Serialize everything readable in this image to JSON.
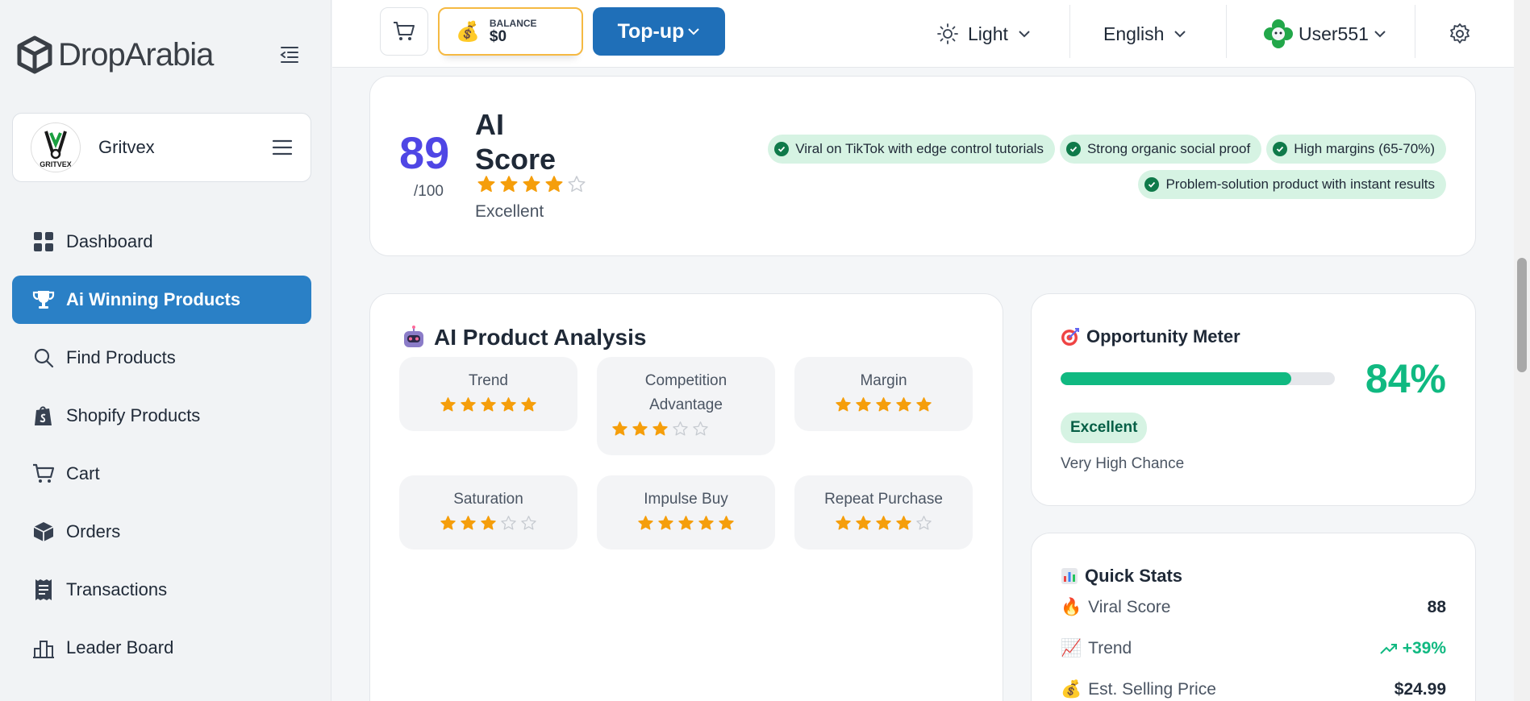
{
  "brand": {
    "name": "DropArabia"
  },
  "store": {
    "name": "Gritvex",
    "logo_text": "GRITVEX"
  },
  "sidebar": {
    "items": [
      {
        "label": "Dashboard",
        "icon": "grid-icon"
      },
      {
        "label": "Ai Winning Products",
        "icon": "trophy-icon",
        "active": true
      },
      {
        "label": "Find Products",
        "icon": "search-icon"
      },
      {
        "label": "Shopify Products",
        "icon": "shopify-bag-icon"
      },
      {
        "label": "Cart",
        "icon": "cart-icon"
      },
      {
        "label": "Orders",
        "icon": "box-icon"
      },
      {
        "label": "Transactions",
        "icon": "receipt-icon"
      },
      {
        "label": "Leader Board",
        "icon": "podium-icon"
      }
    ]
  },
  "topbar": {
    "balance_label": "BALANCE",
    "balance_value": "$0",
    "topup_label": "Top-up",
    "theme_label": "Light",
    "language_label": "English",
    "user_label": "User551"
  },
  "ai_score": {
    "value": "89",
    "out_of": "/100",
    "title": "AI Score",
    "rating": 4,
    "rating_label": "Excellent",
    "tags": [
      "Viral on TikTok with edge control tutorials",
      "Strong organic social proof",
      "High margins (65-70%)",
      "Problem-solution product with instant results"
    ]
  },
  "analysis": {
    "title": "AI Product Analysis",
    "metrics": [
      {
        "label": "Trend",
        "rating": 5
      },
      {
        "label": "Competition Advantage",
        "rating": 3
      },
      {
        "label": "Margin",
        "rating": 5
      },
      {
        "label": "Saturation",
        "rating": 3
      },
      {
        "label": "Impulse Buy",
        "rating": 5
      },
      {
        "label": "Repeat Purchase",
        "rating": 4
      }
    ]
  },
  "opportunity": {
    "title": "Opportunity Meter",
    "percent": 84,
    "percent_label": "84%",
    "badge": "Excellent",
    "subtitle": "Very High Chance"
  },
  "quick_stats": {
    "title": "Quick Stats",
    "rows": [
      {
        "label": "Viral Score",
        "value": "88",
        "emoji": "🔥"
      },
      {
        "label": "Trend",
        "value": "+39%",
        "emoji": "📈"
      },
      {
        "label": "Est. Selling Price",
        "value": "$24.99",
        "emoji": "💰"
      }
    ]
  },
  "colors": {
    "accent": "#2a80c6",
    "star": "#f59e0b",
    "green": "#10b981",
    "score": "#4f46e5"
  }
}
